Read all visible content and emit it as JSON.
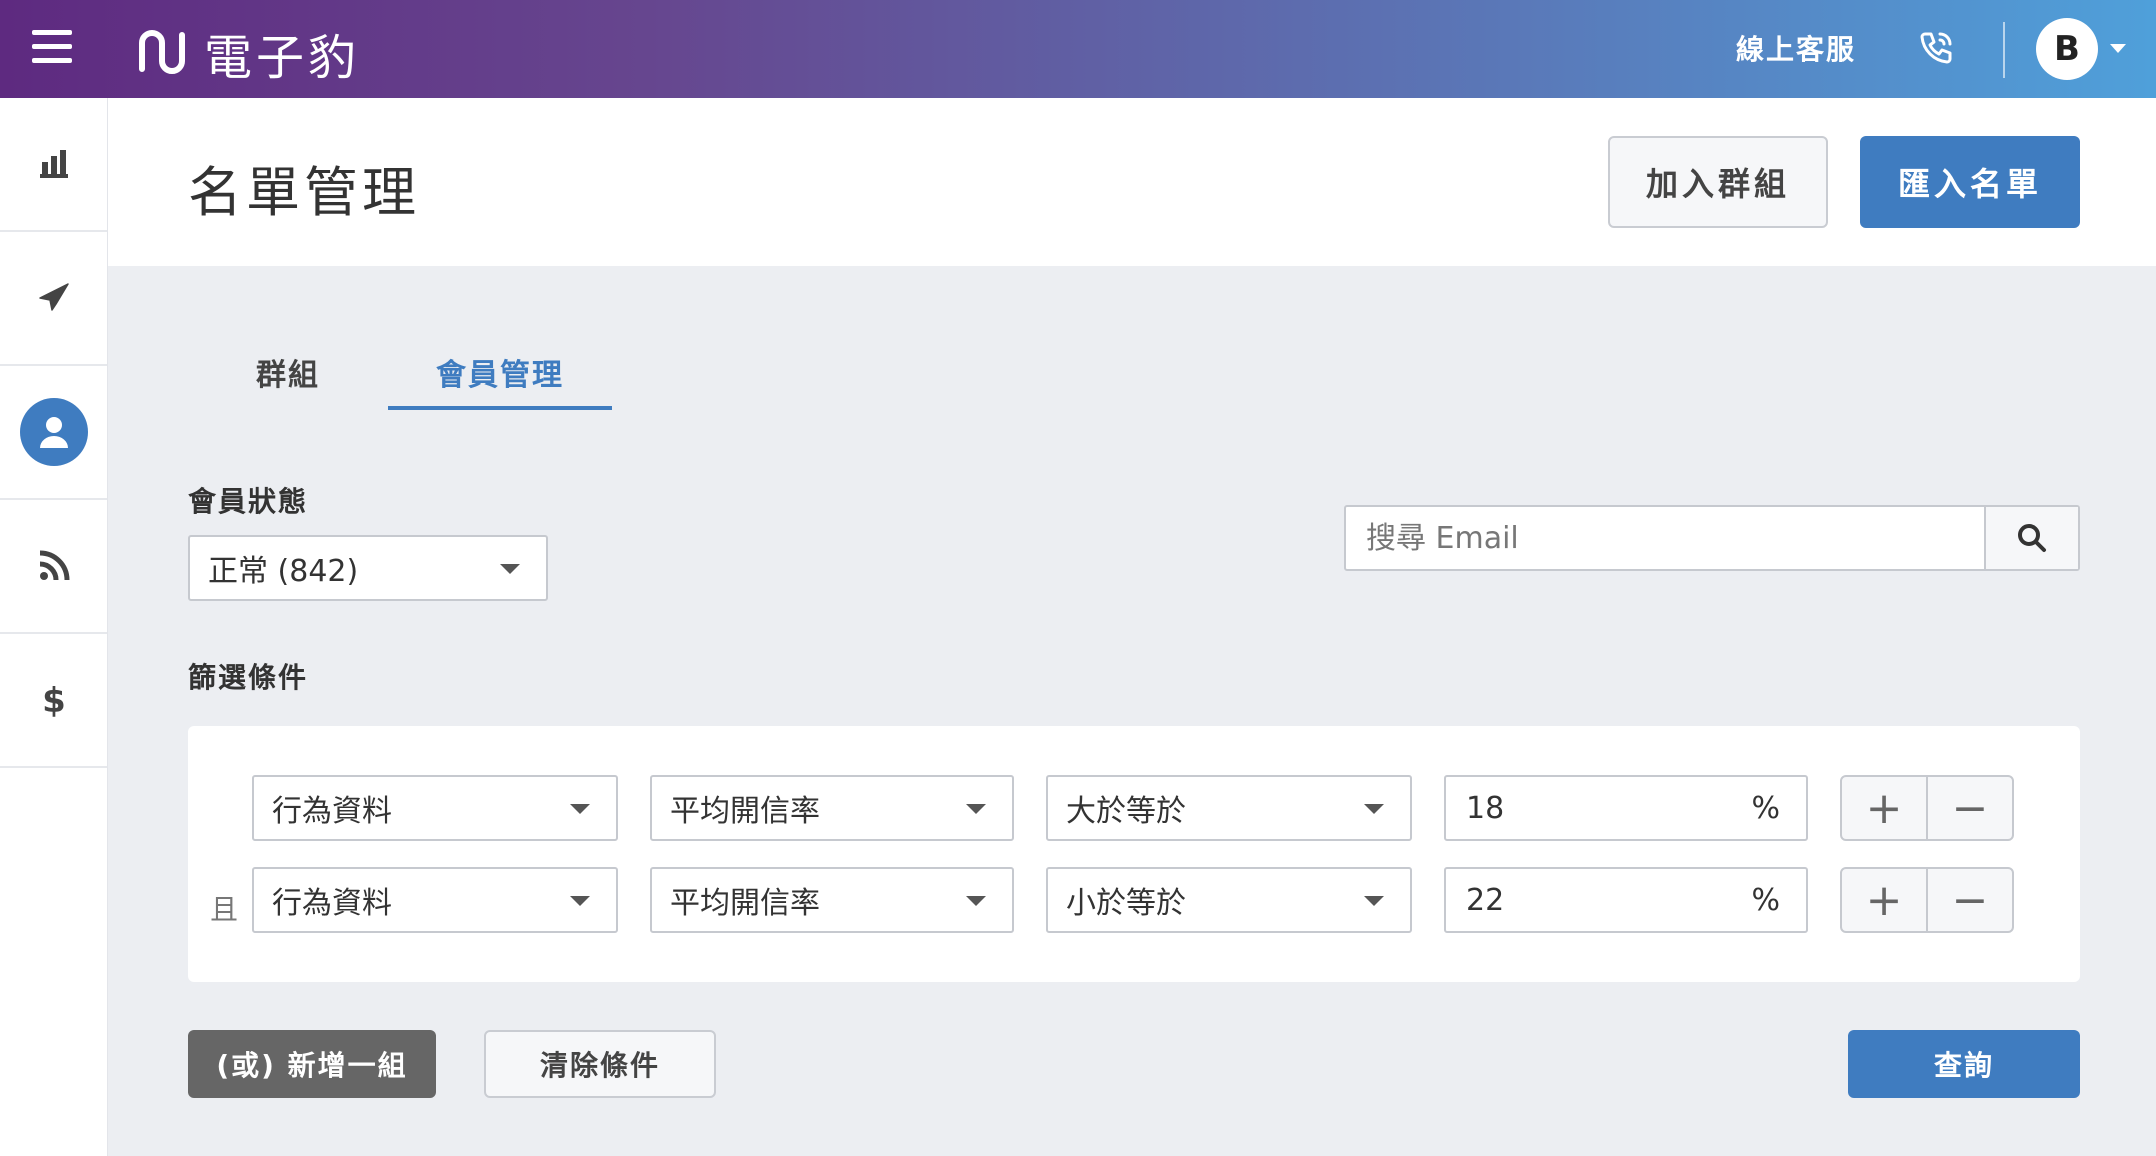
{
  "header": {
    "brand_name": "電子豹",
    "customer_service": "線上客服",
    "avatar_initial": "B",
    "colors": {
      "gradient_start": "#5e2a80",
      "gradient_end": "#4fa0da",
      "accent": "#3f7cc0"
    }
  },
  "sidebar": {
    "items": [
      {
        "icon": "bar-chart-icon"
      },
      {
        "icon": "paper-plane-icon"
      },
      {
        "icon": "user-icon",
        "active": true
      },
      {
        "icon": "rss-icon"
      },
      {
        "icon": "dollar-icon"
      }
    ]
  },
  "page": {
    "title": "名單管理",
    "add_group_label": "加入群組",
    "import_list_label": "匯入名單"
  },
  "tabs": [
    {
      "label": "群組"
    },
    {
      "label": "會員管理",
      "active": true
    }
  ],
  "member_status": {
    "label": "會員狀態",
    "selected": "正常 (842)"
  },
  "search": {
    "placeholder": "搜尋 Email"
  },
  "filters": {
    "label": "篩選條件",
    "rows": [
      {
        "connector": "",
        "category": "行為資料",
        "metric": "平均開信率",
        "operator": "大於等於",
        "value": "18",
        "unit": "%"
      },
      {
        "connector": "且",
        "category": "行為資料",
        "metric": "平均開信率",
        "operator": "小於等於",
        "value": "22",
        "unit": "%"
      }
    ]
  },
  "actions": {
    "add_or_group": "(或) 新增一組",
    "clear_conditions": "清除條件",
    "query": "查詢"
  }
}
